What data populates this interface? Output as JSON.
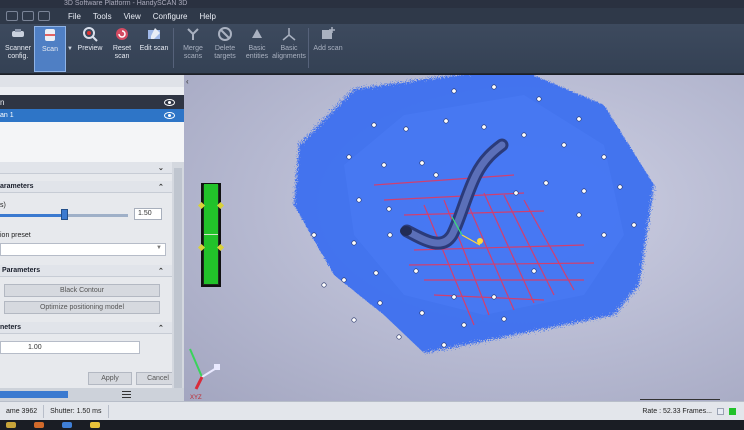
{
  "window": {
    "title": "3D Software Platform - HandySCAN 3D"
  },
  "menu": [
    "File",
    "Tools",
    "View",
    "Configure",
    "Help"
  ],
  "toolbar": [
    {
      "label": "Scanner config.",
      "icon": "scanner-config-icon"
    },
    {
      "label": "Scan",
      "icon": "scan-icon",
      "active": true
    },
    {
      "label": "Preview",
      "icon": "preview-icon"
    },
    {
      "label": "Reset scan",
      "icon": "reset-scan-icon"
    },
    {
      "label": "Edit scan",
      "icon": "edit-scan-icon"
    },
    {
      "label": "Merge scans",
      "icon": "merge-scans-icon",
      "dim": true
    },
    {
      "label": "Delete targets",
      "icon": "delete-targets-icon",
      "dim": true
    },
    {
      "label": "Basic entities",
      "icon": "basic-entities-icon",
      "dim": true
    },
    {
      "label": "Basic alignments",
      "icon": "basic-alignments-icon",
      "dim": true
    },
    {
      "label": "Add scan",
      "icon": "add-scan-icon",
      "dim": true
    }
  ],
  "left_panel": {
    "tree": {
      "scanner_row": "n",
      "scan_row": "an 1"
    },
    "sections": {
      "parameters": "arameters",
      "parameters2": "Parameters",
      "parameters3": "neters"
    },
    "slider": {
      "label": "s)",
      "value": "1.50",
      "level_fraction": 0.5
    },
    "preset_label": "ion preset",
    "buttons": {
      "black_contour": "Black Contour",
      "optimize": "Optimize positioning model",
      "apply": "Apply",
      "cancel": "Cancel"
    },
    "field_value": "1.00"
  },
  "viewport": {
    "axes_label": "XYZ"
  },
  "status": {
    "frame": "ame 3962",
    "shutter": "Shutter: 1.50 ms",
    "rate": "Rate : 52.33 Frames..."
  },
  "colors": {
    "accent": "#2e75c7",
    "scan_surface": "#3d6ff0",
    "laser": "#e8365a",
    "meter": "#22c22a"
  }
}
